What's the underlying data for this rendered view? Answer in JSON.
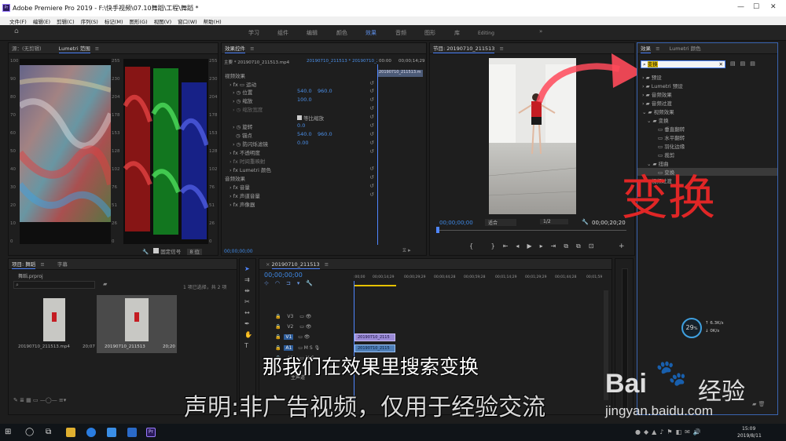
{
  "window": {
    "title": "Adobe Premiere Pro 2019 - F:\\快手视频\\07.10舞蹈\\工程\\舞蹈 *"
  },
  "menu": [
    "文件(F)",
    "编辑(E)",
    "剪辑(C)",
    "序列(S)",
    "标记(M)",
    "图形(G)",
    "视图(V)",
    "窗口(W)",
    "帮助(H)"
  ],
  "workspaces": [
    "学习",
    "组件",
    "编辑",
    "颜色",
    "效果",
    "音频",
    "图形",
    "库",
    "Editing"
  ],
  "workspace_active": "效果",
  "scopes": {
    "tab_source": "源：(无剪辑)",
    "tab_lumetri": "Lumetri 范围",
    "left_scale": [
      "100",
      "90",
      "80",
      "70",
      "60",
      "50",
      "40",
      "30",
      "20",
      "10",
      "0"
    ],
    "mid_scale": [
      "255",
      "230",
      "204",
      "178",
      "153",
      "128",
      "102",
      "76",
      "51",
      "26",
      "0"
    ],
    "right_scale": [
      "255",
      "230",
      "204",
      "178",
      "153",
      "128",
      "102",
      "76",
      "51",
      "26",
      "0"
    ],
    "clamp_label": "固定信号",
    "bit_label": "8 位"
  },
  "effect_controls": {
    "tab": "效果控件",
    "master": "主要 * 20190710_211513.mp4",
    "seq": "20190710_211513 * 20190710_2...",
    "ruler_start": "00:00",
    "ruler_end": "00;00;14;29",
    "clip_name": "20190710_211513.m",
    "video_effects": "视频效果",
    "motion": "运动",
    "position_label": "位置",
    "position_x": "540.0",
    "position_y": "960.0",
    "scale_label": "缩放",
    "scale_val": "100.0",
    "scale_width_label": "缩放宽度",
    "uniform_label": "等比缩放",
    "rotation_label": "旋转",
    "rotation_val": "0.0",
    "anchor_label": "锚点",
    "anchor_x": "540.0",
    "anchor_y": "960.0",
    "antiflicker_label": "防闪烁滤镜",
    "antiflicker_val": "0.00",
    "opacity_label": "不透明度",
    "time_remap_label": "时间重映射",
    "lumetri_label": "Lumetri 颜色",
    "audio_effects": "音频效果",
    "volume_label": "音量",
    "channel_label": "声道音量",
    "panner_label": "声像器",
    "timecode": "00;00;00;00"
  },
  "program": {
    "tab": "节目: 20190710_211513",
    "timecode_left": "00;00;00;00",
    "fit": "适合",
    "ratio": "1/2",
    "timecode_right": "00;00;20;20"
  },
  "project": {
    "tab_project": "项目: 舞蹈",
    "tab_media": "字幕",
    "file": "舞蹈.prproj",
    "selection": "1 项已选择，共 2 项",
    "items": [
      {
        "name": "20190710_211513.mp4",
        "duration": "20;07"
      },
      {
        "name": "20190710_211513",
        "duration": "20;20"
      }
    ]
  },
  "timeline": {
    "tab": "20190710_211513",
    "timecode": "00;00;00;00",
    "ruler": [
      ":00;00",
      "00;00;14;29",
      "00;00;29;29",
      "00;00;44;28",
      "00;00;59;28",
      "00;01;14;29",
      "00;01;29;29",
      "00;01;44;28",
      "00;01;59"
    ],
    "tracks_v": [
      "V3",
      "V2",
      "V1"
    ],
    "tracks_a": [
      "A1",
      "A2"
    ],
    "master": "主声道",
    "clip_v": "20190710_2115",
    "clip_a": "20190710_2115"
  },
  "effects_panel": {
    "tab_effects": "效果",
    "tab_lumetri": "Lumetri 颜色",
    "search_value": "变换",
    "items": [
      {
        "label": "预设",
        "level": 0
      },
      {
        "label": "Lumetri 预设",
        "level": 0
      },
      {
        "label": "音频效果",
        "level": 0
      },
      {
        "label": "音频过渡",
        "level": 0
      },
      {
        "label": "视频效果",
        "level": 0
      },
      {
        "label": "变换",
        "level": 1
      },
      {
        "label": "垂直翻转",
        "level": 2
      },
      {
        "label": "水平翻转",
        "level": 2
      },
      {
        "label": "羽化边缘",
        "level": 2
      },
      {
        "label": "裁剪",
        "level": 2
      },
      {
        "label": "扭曲",
        "level": 1
      },
      {
        "label": "变换",
        "level": 2
      },
      {
        "label": "视频过渡",
        "level": 0
      }
    ]
  },
  "overlays": {
    "big_red_text": "变换",
    "subtitle": "那我们在效果里搜索变换",
    "disclaimer": "声明:非广告视频，仅用于经验交流",
    "baidu_logo": "Bai",
    "baidu_jingyan": "经验",
    "baidu_url": "jingyan.baidu.com",
    "perf_percent": "29",
    "perf_up": "6.3",
    "perf_down": "0"
  },
  "taskbar": {
    "time": "15:09",
    "date": "2019/8/11"
  },
  "colors": {
    "accent": "#4f86ff",
    "red_text": "#e02626",
    "timecode_blue": "#3f8ae8"
  }
}
